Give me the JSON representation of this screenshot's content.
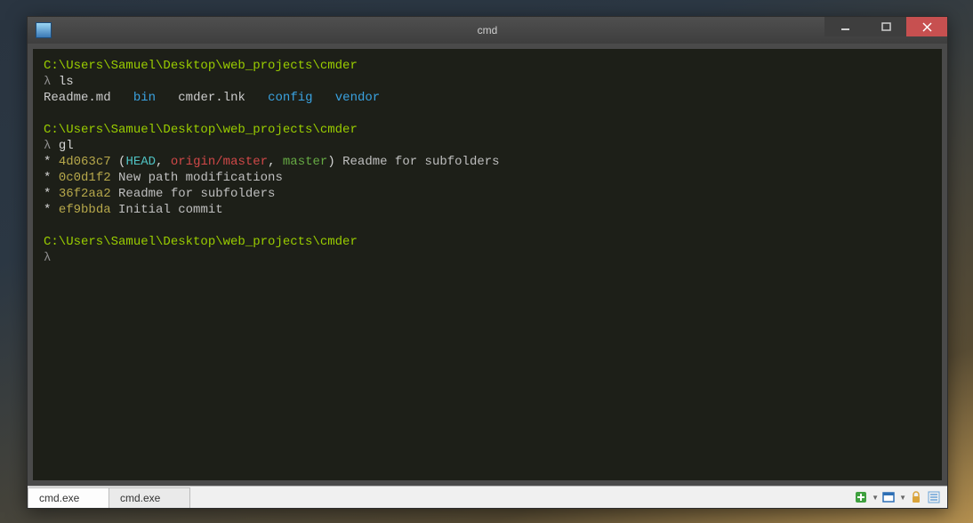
{
  "window": {
    "title": "cmd"
  },
  "terminal": {
    "path": "C:\\Users\\Samuel\\Desktop\\web_projects\\cmder",
    "prompt_symbol": "λ",
    "cmd_ls": "ls",
    "ls_output": {
      "readme": "Readme.md",
      "bin": "bin",
      "lnk": "cmder.lnk",
      "config": "config",
      "vendor": "vendor"
    },
    "cmd_gl": "gl",
    "git_log": [
      {
        "star": "*",
        "hash": "4d063c7",
        "paren_open": " (",
        "head": "HEAD",
        "sep1": ", ",
        "origin": "origin/master",
        "sep2": ", ",
        "branch": "master",
        "paren_close": ") ",
        "msg": "Readme for subfolders"
      },
      {
        "star": "*",
        "hash": "0c0d1f2",
        "msg": "New path modifications"
      },
      {
        "star": "*",
        "hash": "36f2aa2",
        "msg": "Readme for subfolders"
      },
      {
        "star": "*",
        "hash": "ef9bbda",
        "msg": "Initial commit"
      }
    ]
  },
  "tabs": [
    {
      "label": "cmd.exe"
    },
    {
      "label": "cmd.exe"
    }
  ]
}
